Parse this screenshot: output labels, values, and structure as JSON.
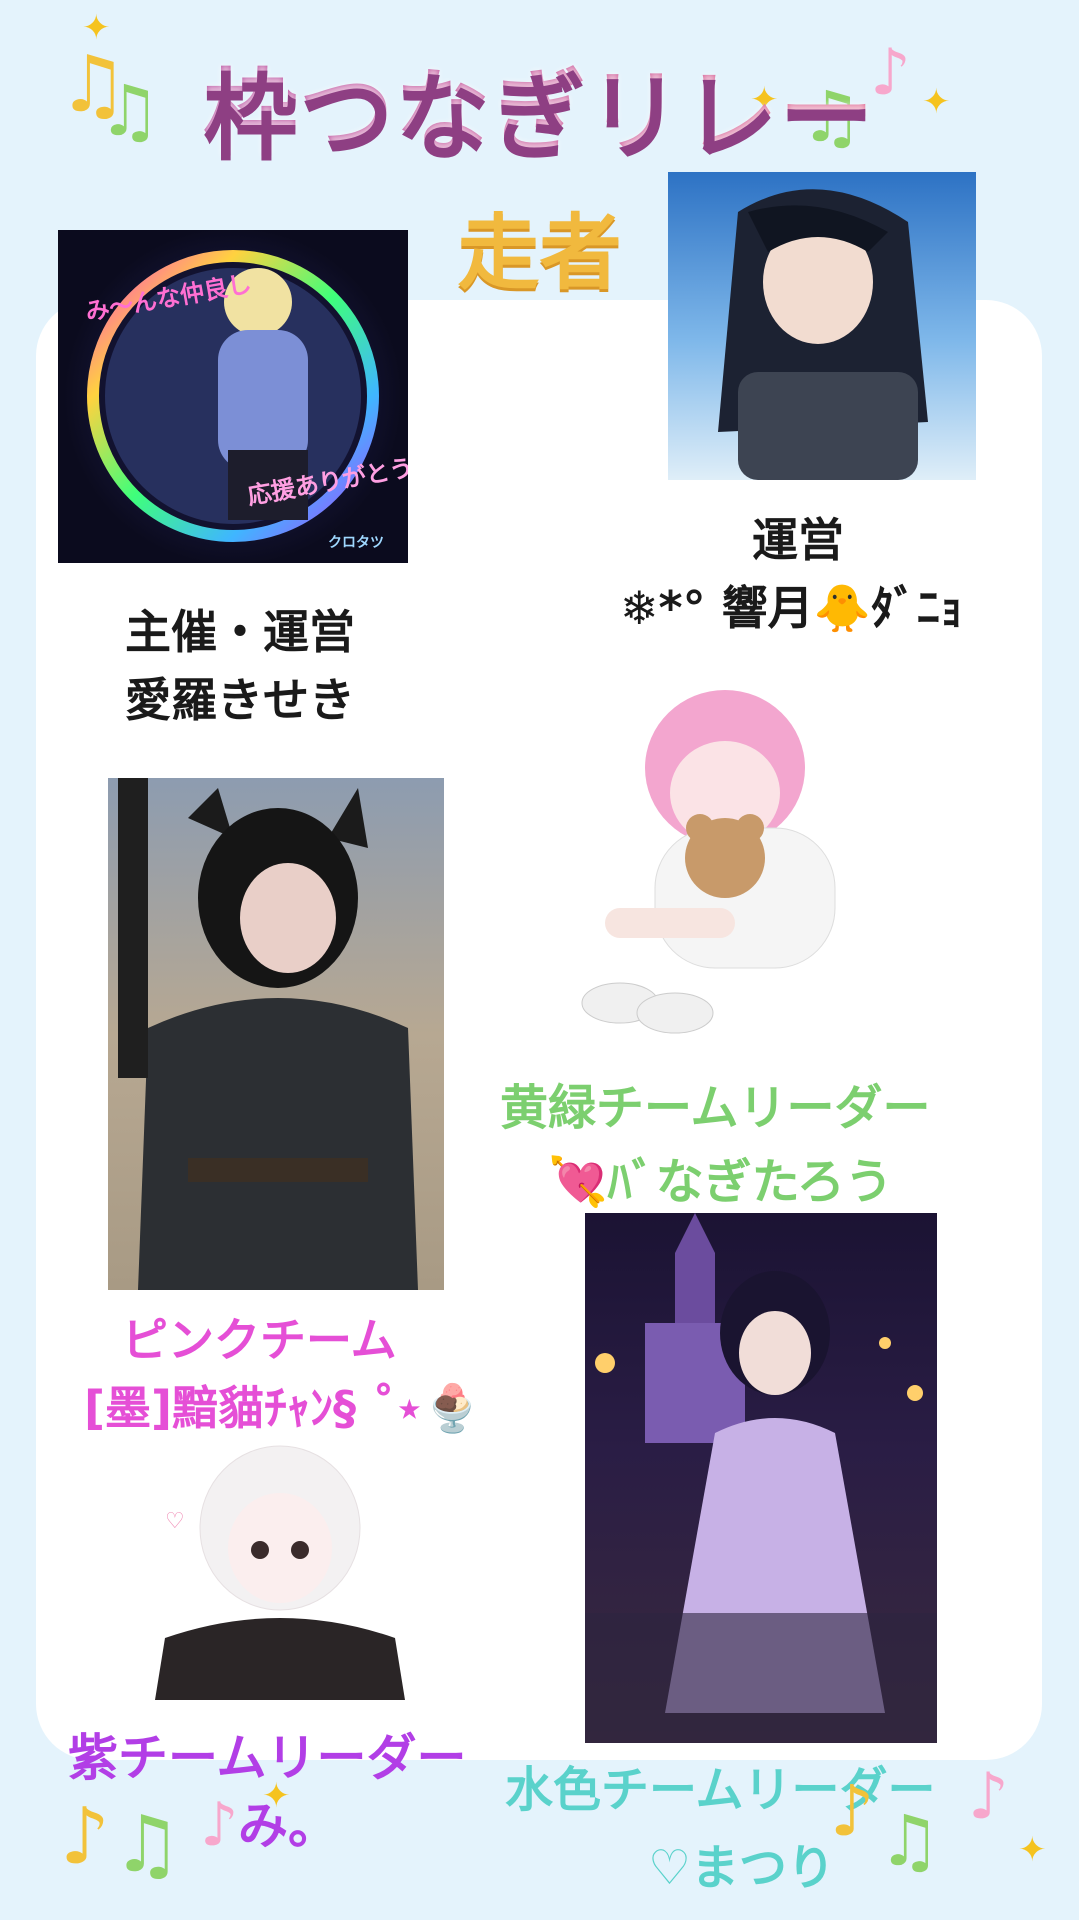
{
  "header": {
    "title": "枠つなぎリレー",
    "subtitle": "走者"
  },
  "runners": [
    {
      "role": "主催・運営",
      "name": "愛羅きせき",
      "avatar_text_1": "み〜んな仲良し",
      "avatar_text_2": "応援ありがとう",
      "avatar_signature": "クロタツ"
    },
    {
      "role": "運営",
      "name": "❄*° 響月🐥ﾀﾞﾆｮ"
    },
    {
      "role": "黄緑チームリーダー",
      "name": "💘ﾊﾞなぎたろう"
    },
    {
      "role": "ピンクチーム",
      "name": "[墨]黯貓ﾁｬﾝ§ ˚⋆🍨"
    },
    {
      "role": "紫チームリーダー",
      "name": "み。"
    },
    {
      "role": "水色チームリーダー",
      "name": "♡まつり"
    }
  ],
  "colors": {
    "background": "#e4f3fc",
    "title": "#b7579c",
    "subtitle": "#f1b93e",
    "green_team": "#7ccf6f",
    "pink_team": "#e54fd6",
    "purple_team": "#b23ee6",
    "aqua_team": "#5ad2cb"
  },
  "icons": [
    "music-note-icon",
    "sparkle-icon"
  ]
}
